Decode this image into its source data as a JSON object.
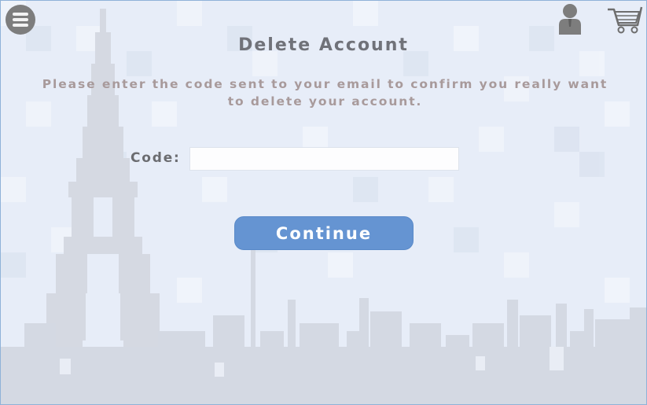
{
  "header": {
    "menu_icon": "hamburger-menu-icon",
    "user_icon": "user-account-icon",
    "cart_icon": "shopping-cart-icon"
  },
  "dialog": {
    "title": "Delete Account",
    "instructions": "Please enter the code sent to your email to confirm you really want to delete your account.",
    "code_label": "Code:",
    "code_value": "",
    "continue_label": "Continue"
  },
  "theme": {
    "background": "#e7edf8",
    "skyline_color": "#d4d9e3",
    "button_color": "#6594d2",
    "title_color": "#707279",
    "instruction_color": "#a89a9b",
    "icon_color": "#7d7d7d"
  }
}
